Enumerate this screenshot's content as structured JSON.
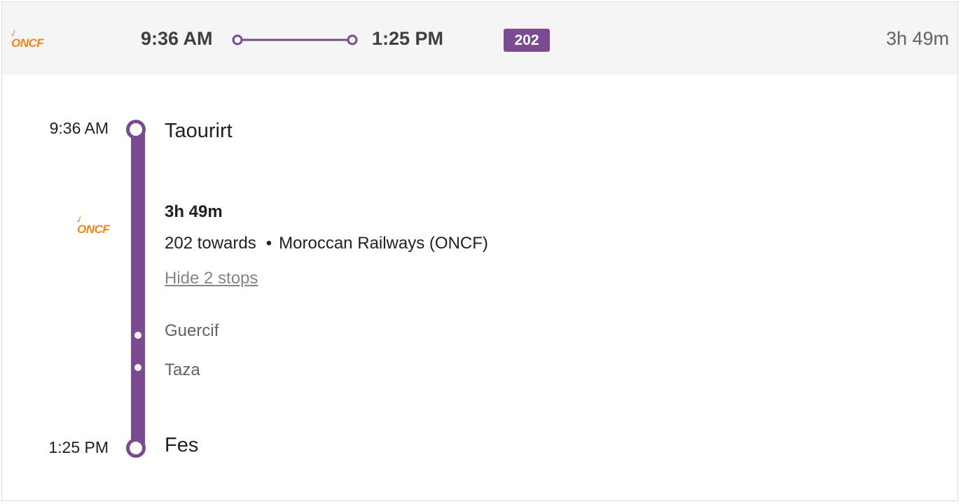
{
  "header": {
    "operator_logo": "ONCF",
    "depart_time": "9:36 AM",
    "arrive_time": "1:25 PM",
    "train_number": "202",
    "duration": "3h 49m"
  },
  "itinerary": {
    "origin": {
      "time": "9:36 AM",
      "station": "Taourirt"
    },
    "segment": {
      "operator_logo": "ONCF",
      "duration": "3h 49m",
      "route": "202 towards",
      "separator": "•",
      "operator": "Moroccan Railways (ONCF)",
      "toggle_label": "Hide 2 stops",
      "intermediate_stops": [
        "Guercif",
        "Taza"
      ]
    },
    "destination": {
      "time": "1:25 PM",
      "station": "Fes"
    }
  },
  "colors": {
    "line": "#7b4a91",
    "logo": "#f0861a",
    "header_bg": "#f5f5f5"
  }
}
